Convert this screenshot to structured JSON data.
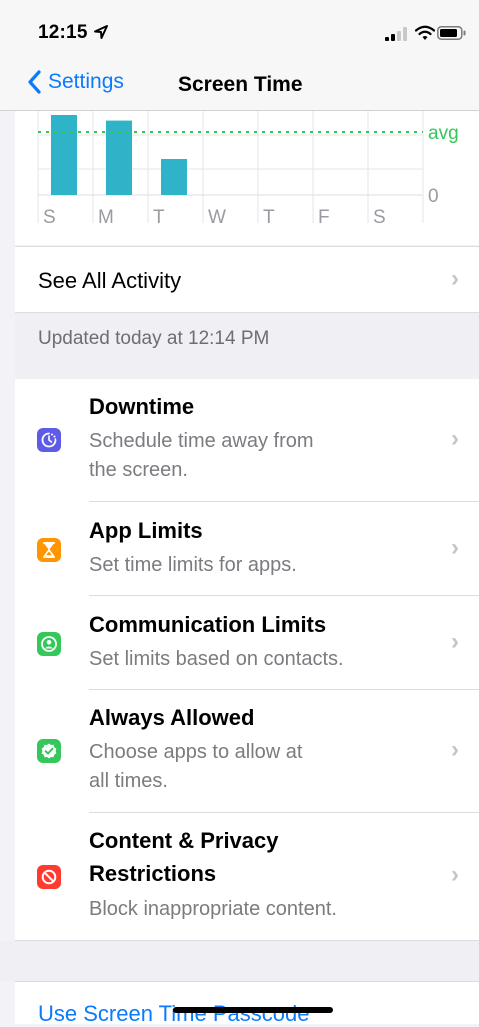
{
  "status": {
    "time": "12:15"
  },
  "nav": {
    "back_label": "Settings",
    "title": "Screen Time"
  },
  "chart_data": {
    "type": "bar",
    "categories": [
      "S",
      "M",
      "T",
      "W",
      "T",
      "F",
      "S"
    ],
    "values": [
      1.0,
      0.93,
      0.45,
      0,
      0,
      0,
      0
    ],
    "avg_label": "avg",
    "zero_label": "0",
    "colors": {
      "bar": "#2fb3c8",
      "avg": "#34c759"
    }
  },
  "see_all": {
    "label": "See All Activity"
  },
  "updated": {
    "text": "Updated today at 12:14 PM"
  },
  "rows": [
    {
      "title": "Downtime",
      "subtitle": [
        "Schedule time away from",
        "the screen."
      ],
      "icon": "moon-clock-icon",
      "color": "#5e5ce6"
    },
    {
      "title": "App Limits",
      "subtitle": [
        "Set time limits for apps."
      ],
      "icon": "hourglass-icon",
      "color": "#ff9500"
    },
    {
      "title": "Communication Limits",
      "subtitle": [
        "Set limits based on contacts."
      ],
      "icon": "person-circle-icon",
      "color": "#34c759"
    },
    {
      "title": "Always Allowed",
      "subtitle": [
        "Choose apps to allow at",
        "all times."
      ],
      "icon": "checkmark-badge-icon",
      "color": "#34c759"
    },
    {
      "title": [
        "Content & Privacy",
        "Restrictions"
      ],
      "subtitle": [
        "Block inappropriate content."
      ],
      "icon": "no-sign-icon",
      "color": "#ff3b30"
    }
  ],
  "passcode": {
    "label": "Use Screen Time Passcode"
  }
}
